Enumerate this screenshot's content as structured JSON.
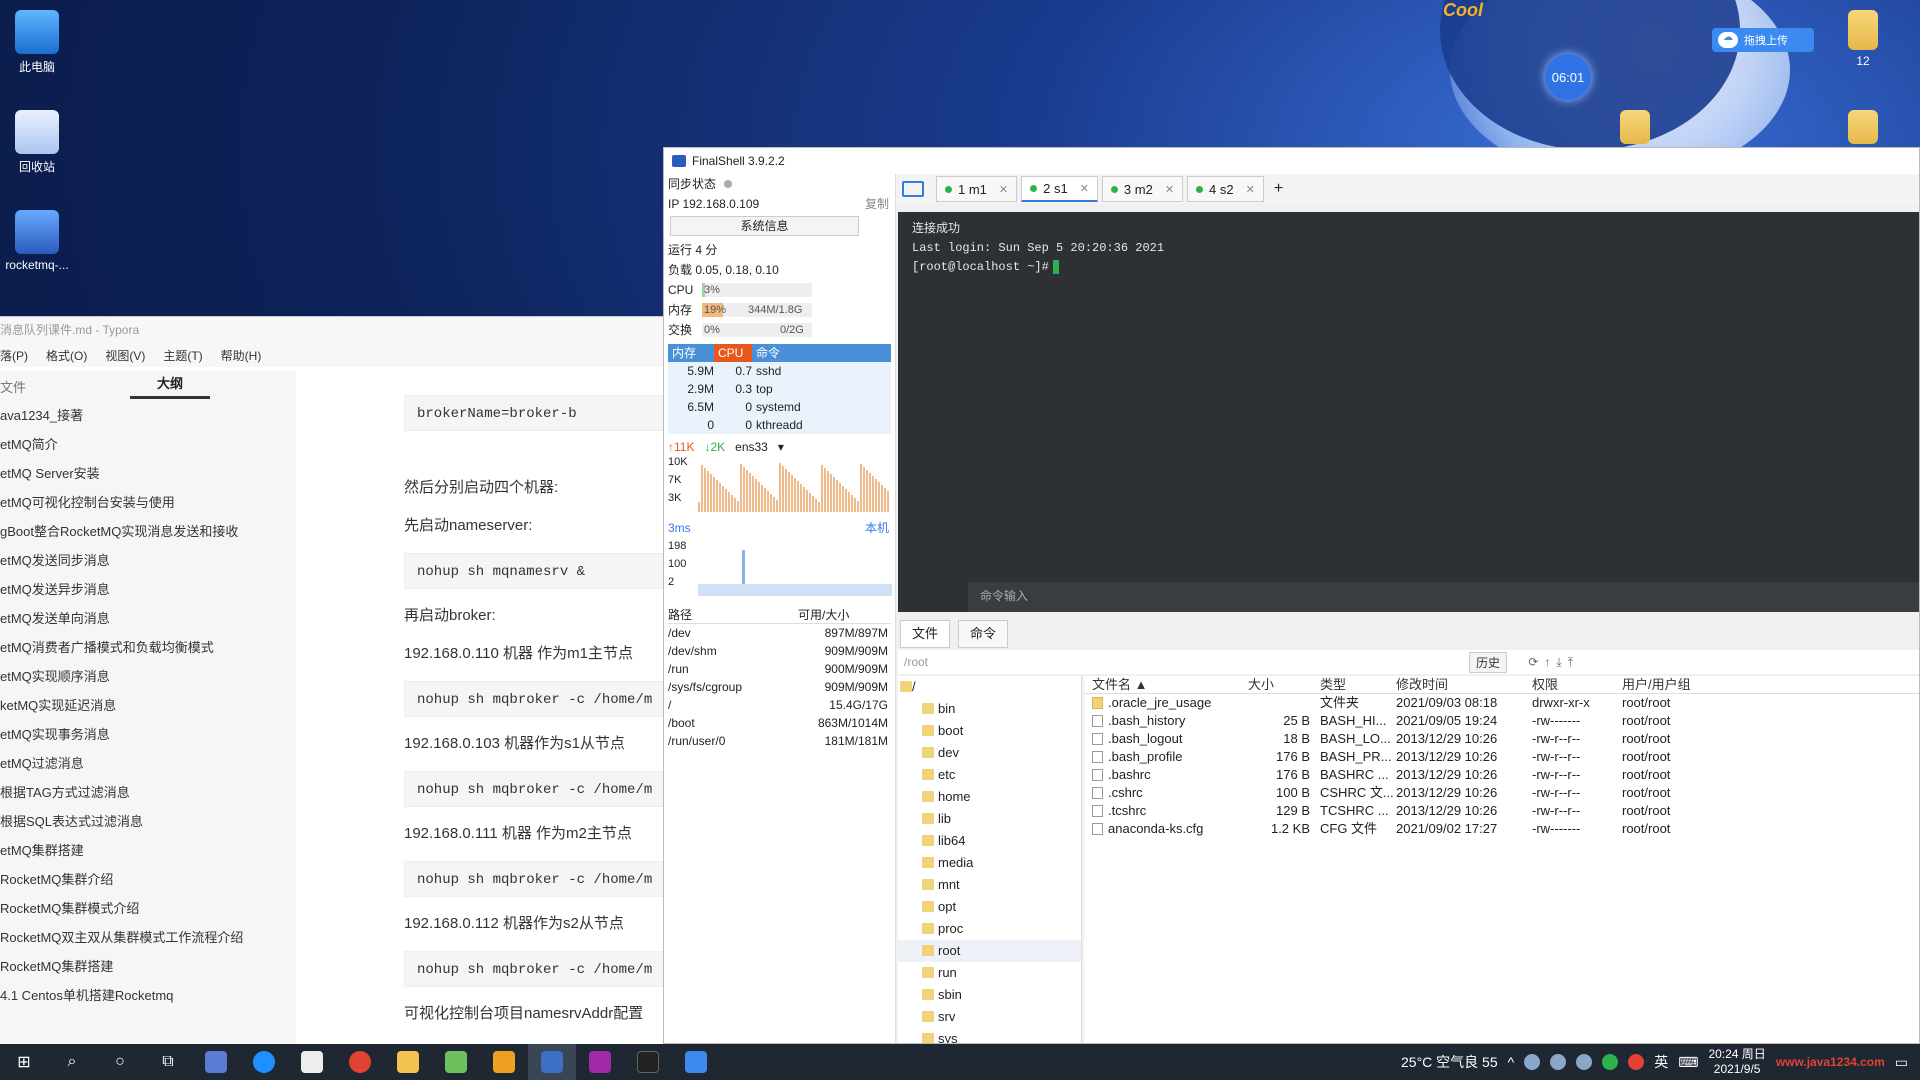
{
  "desktop": {
    "icons": [
      {
        "label": "此电脑",
        "icon": "computer-icon"
      },
      {
        "label": "回收站",
        "icon": "recycle-bin-icon"
      },
      {
        "label": "rocketmq-...",
        "icon": "archive-icon"
      }
    ],
    "right_icon_label": "12",
    "clock_bubble": "06:01",
    "cool_badge": "Cool",
    "upload_button": "拖拽上传"
  },
  "typora": {
    "title": "消息队列课件.md - Typora",
    "menu": [
      "落(P)",
      "格式(O)",
      "视图(V)",
      "主题(T)",
      "帮助(H)"
    ],
    "sidebar_tabs": [
      "文件",
      "大纲"
    ],
    "outline": [
      "ava1234_接著",
      "etMQ简介",
      "etMQ Server安装",
      "etMQ可视化控制台安装与使用",
      "gBoot整合RocketMQ实现消息发送和接收",
      "etMQ发送同步消息",
      "etMQ发送异步消息",
      "etMQ发送单向消息",
      "etMQ消费者广播模式和负载均衡模式",
      "etMQ实现顺序消息",
      "ketMQ实现延迟消息",
      "etMQ实现事务消息",
      "etMQ过滤消息",
      "根据TAG方式过滤消息",
      "根据SQL表达式过滤消息",
      "etMQ集群搭建",
      "RocketMQ集群介绍",
      "RocketMQ集群模式介绍",
      "RocketMQ双主双从集群模式工作流程介绍",
      "RocketMQ集群搭建",
      "4.1 Centos单机搭建Rocketmq"
    ],
    "editor": {
      "code1": "brokerName=broker-b",
      "p1": "然后分别启动四个机器:",
      "p2": "先启动nameserver:",
      "code2": "nohup sh mqnamesrv &",
      "p3": "再启动broker:",
      "p4": "192.168.0.110 机器 作为m1主节点",
      "code3": "nohup sh mqbroker -c /home/m",
      "p5": "192.168.0.103 机器作为s1从节点",
      "code4": "nohup sh mqbroker -c /home/m",
      "p6": "192.168.0.111 机器 作为m2主节点",
      "code5": "nohup sh mqbroker -c /home/m",
      "p7": "192.168.0.112 机器作为s2从节点",
      "code6": "nohup sh mqbroker -c /home/m",
      "p8": "可视化控制台项目namesrvAddr配置"
    }
  },
  "finalshell": {
    "title": "FinalShell 3.9.2.2",
    "sync_label": "同步状态",
    "ip": "IP 192.168.0.109",
    "copy": "复制",
    "sysinfo": "系统信息",
    "uptime": "运行 4 分",
    "load": "负载 0.05, 0.18, 0.10",
    "cpu": {
      "label": "CPU",
      "value": "3%",
      "percent": 3
    },
    "mem": {
      "label": "内存",
      "value": "19%",
      "detail": "344M/1.8G",
      "percent": 19
    },
    "swap": {
      "label": "交换",
      "value": "0%",
      "detail": "0/2G",
      "percent": 0
    },
    "proc_head": [
      "内存",
      "CPU",
      "命令"
    ],
    "procs": [
      {
        "mem": "5.9M",
        "cpu": "0.7",
        "cmd": "sshd"
      },
      {
        "mem": "2.9M",
        "cpu": "0.3",
        "cmd": "top"
      },
      {
        "mem": "6.5M",
        "cpu": "0",
        "cmd": "systemd"
      },
      {
        "mem": "0",
        "cpu": "0",
        "cmd": "kthreadd"
      }
    ],
    "net": {
      "up": "↑11K",
      "down": "↓2K",
      "iface": "ens33"
    },
    "net_axis": [
      "10K",
      "7K",
      "3K"
    ],
    "latency": {
      "label": "3ms",
      "host": "本机",
      "axis": [
        "198",
        "100",
        "2"
      ]
    },
    "disk_head": [
      "路径",
      "可用/大小"
    ],
    "disks": [
      {
        "path": "/dev",
        "size": "897M/897M"
      },
      {
        "path": "/dev/shm",
        "size": "909M/909M"
      },
      {
        "path": "/run",
        "size": "900M/909M"
      },
      {
        "path": "/sys/fs/cgroup",
        "size": "909M/909M"
      },
      {
        "path": "/",
        "size": "15.4G/17G"
      },
      {
        "path": "/boot",
        "size": "863M/1014M"
      },
      {
        "path": "/run/user/0",
        "size": "181M/181M"
      }
    ],
    "tabs": [
      {
        "label": "1 m1"
      },
      {
        "label": "2 s1"
      },
      {
        "label": "3 m2"
      },
      {
        "label": "4 s2"
      }
    ],
    "add_tab": "+",
    "terminal": [
      "连接成功",
      "Last login: Sun Sep  5 20:20:36 2021",
      "[root@localhost ~]#"
    ],
    "cmd_placeholder": "命令输入",
    "bottom_tabs": [
      "文件",
      "命令"
    ],
    "path": "/root",
    "history": "历史",
    "tree": [
      "/",
      "bin",
      "boot",
      "dev",
      "etc",
      "home",
      "lib",
      "lib64",
      "media",
      "mnt",
      "opt",
      "proc",
      "root",
      "run",
      "sbin",
      "srv",
      "sys"
    ],
    "file_head": [
      "文件名 ▲",
      "大小",
      "类型",
      "修改时间",
      "权限",
      "用户/用户组"
    ],
    "files": [
      {
        "name": ".oracle_jre_usage",
        "size": "",
        "type": "文件夹",
        "mtime": "2021/09/03 08:18",
        "perm": "drwxr-xr-x",
        "owner": "root/root",
        "dir": true
      },
      {
        "name": ".bash_history",
        "size": "25 B",
        "type": "BASH_HI...",
        "mtime": "2021/09/05 19:24",
        "perm": "-rw-------",
        "owner": "root/root",
        "dir": false
      },
      {
        "name": ".bash_logout",
        "size": "18 B",
        "type": "BASH_LO...",
        "mtime": "2013/12/29 10:26",
        "perm": "-rw-r--r--",
        "owner": "root/root",
        "dir": false
      },
      {
        "name": ".bash_profile",
        "size": "176 B",
        "type": "BASH_PR...",
        "mtime": "2013/12/29 10:26",
        "perm": "-rw-r--r--",
        "owner": "root/root",
        "dir": false
      },
      {
        "name": ".bashrc",
        "size": "176 B",
        "type": "BASHRC ...",
        "mtime": "2013/12/29 10:26",
        "perm": "-rw-r--r--",
        "owner": "root/root",
        "dir": false
      },
      {
        "name": ".cshrc",
        "size": "100 B",
        "type": "CSHRC 文...",
        "mtime": "2013/12/29 10:26",
        "perm": "-rw-r--r--",
        "owner": "root/root",
        "dir": false
      },
      {
        "name": ".tcshrc",
        "size": "129 B",
        "type": "TCSHRC ...",
        "mtime": "2013/12/29 10:26",
        "perm": "-rw-r--r--",
        "owner": "root/root",
        "dir": false
      },
      {
        "name": "anaconda-ks.cfg",
        "size": "1.2 KB",
        "type": "CFG 文件",
        "mtime": "2021/09/02 17:27",
        "perm": "-rw-------",
        "owner": "root/root",
        "dir": false
      }
    ]
  },
  "taskbar": {
    "weather": "25°C 空气良 55",
    "ime": "英",
    "time": "20:24 周日",
    "date": "2021/9/5",
    "watermark": "www.java1234.com"
  }
}
